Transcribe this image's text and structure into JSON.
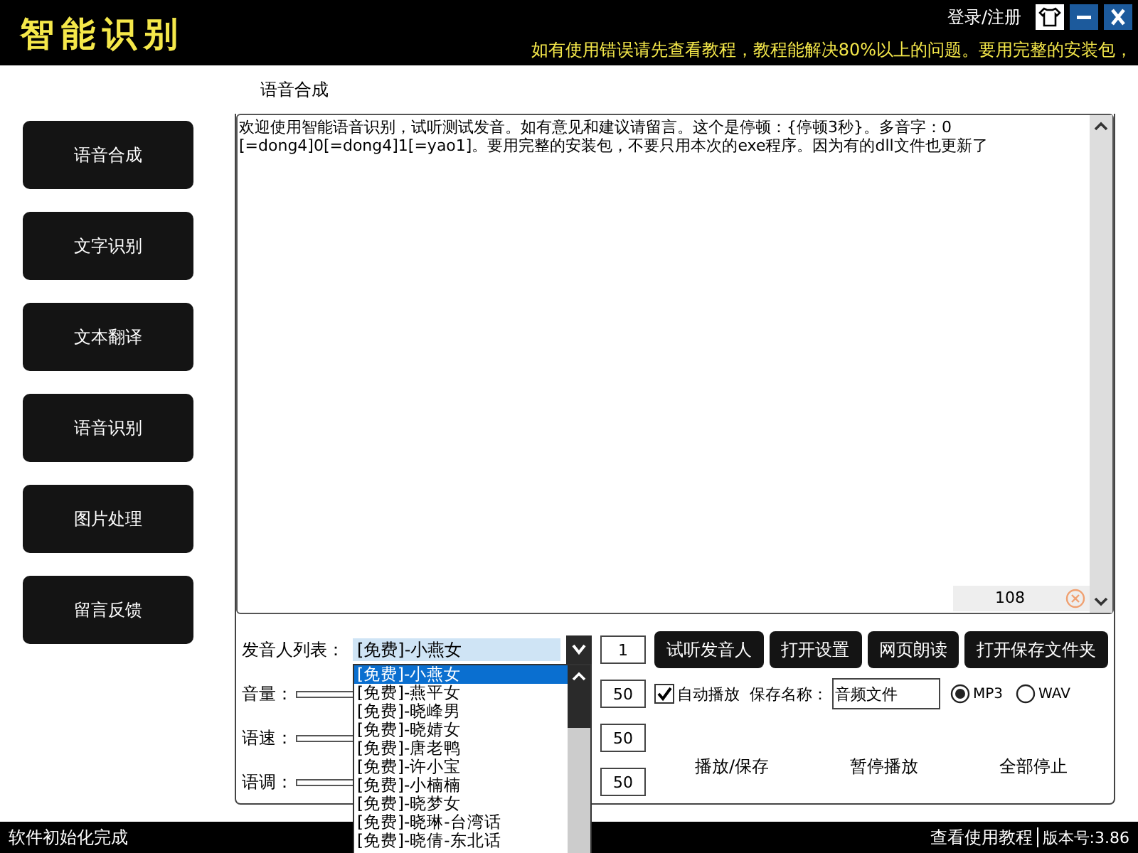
{
  "header": {
    "title": "智能识别",
    "login_link": "登录/注册",
    "marquee": "如有使用错误请先查看教程，教程能解决80%以上的问题。要用完整的安装包，"
  },
  "sidebar": {
    "items": [
      {
        "label": "语音合成"
      },
      {
        "label": "文字识别"
      },
      {
        "label": "文本翻译"
      },
      {
        "label": "语音识别"
      },
      {
        "label": "图片处理"
      },
      {
        "label": "留言反馈"
      }
    ]
  },
  "section_title": "语音合成",
  "editor": {
    "lines": [
      "欢迎使用智能语音识别，试听测试发音。如有意见和建议请留言。这个是停顿：{停顿3秒}。多音字：0",
      "[=dong4]0[=dong4]1[=yao1]。要用完整的安装包，不要只用本次的exe程序。因为有的dll文件也更新了"
    ],
    "char_count": "108"
  },
  "voice_select": {
    "label": "发音人列表：",
    "value": "[免费]-小燕女",
    "options": [
      {
        "label": "[免费]-小燕女",
        "selected": true
      },
      {
        "label": "[免费]-燕平女",
        "selected": false
      },
      {
        "label": "[免费]-晓峰男",
        "selected": false
      },
      {
        "label": "[免费]-晓婧女",
        "selected": false
      },
      {
        "label": "[免费]-唐老鸭",
        "selected": false
      },
      {
        "label": "[免费]-许小宝",
        "selected": false
      },
      {
        "label": "[免费]-小楠楠",
        "selected": false
      },
      {
        "label": "[免费]-晓梦女",
        "selected": false
      },
      {
        "label": "[免费]-晓琳-台湾话",
        "selected": false
      },
      {
        "label": "[免费]-晓倩-东北话",
        "selected": false
      }
    ]
  },
  "count_field": "1",
  "buttons": [
    "试听发音人",
    "打开设置",
    "网页朗读",
    "打开保存文件夹"
  ],
  "sliders": [
    {
      "label": "音量：",
      "value": "50"
    },
    {
      "label": "语速：",
      "value": "50"
    },
    {
      "label": "语调：",
      "value": "50"
    }
  ],
  "auto_play": {
    "label": "自动播放",
    "checked": true
  },
  "save_name": {
    "label": "保存名称：",
    "value": "音频文件"
  },
  "formats": [
    {
      "label": "MP3",
      "selected": true
    },
    {
      "label": "WAV",
      "selected": false
    }
  ],
  "actions": [
    "播放/保存",
    "暂停播放",
    "全部停止"
  ],
  "status_bar": {
    "message": "软件初始化完成",
    "help_link": "查看使用教程",
    "version": "版本号:3.86"
  }
}
